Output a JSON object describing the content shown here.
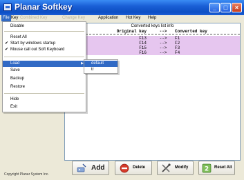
{
  "window": {
    "title": "Planar Softkey"
  },
  "menubar": {
    "items": [
      {
        "label": "File"
      },
      {
        "label": "Key"
      },
      {
        "label": "Combined Key"
      },
      {
        "label": "Change Key"
      },
      {
        "label": "Application"
      },
      {
        "label": "Hot Key"
      },
      {
        "label": "Help"
      }
    ]
  },
  "file_menu": {
    "items": [
      {
        "label": "Disable",
        "checked": false
      },
      {
        "label": "Reset All",
        "checked": false
      },
      {
        "label": "Start by windows startup",
        "checked": true,
        "check": "✔"
      },
      {
        "label": "Mouse call out Soft Keyboard",
        "checked": true,
        "check": "✔"
      },
      {
        "label": "Load",
        "has_submenu": true,
        "arrow": "▶"
      },
      {
        "label": "Save"
      },
      {
        "label": "Backup"
      },
      {
        "label": "Restore"
      },
      {
        "label": "Hide"
      },
      {
        "label": "Exit"
      }
    ]
  },
  "load_submenu": {
    "items": [
      {
        "label": "default"
      },
      {
        "label": "tr"
      }
    ]
  },
  "key_list": {
    "title": "Converted keys list info",
    "headers": {
      "original": "Original key",
      "arrow": "-->",
      "converted": "Converted key"
    },
    "rows": [
      {
        "original": "F13",
        "arrow": "-->",
        "converted": "F1"
      },
      {
        "original": "F14",
        "arrow": "-->",
        "converted": "F2"
      },
      {
        "original": "F15",
        "arrow": "-->",
        "converted": "F3"
      },
      {
        "original": "F16",
        "arrow": "-->",
        "converted": "F4"
      }
    ]
  },
  "buttons": {
    "add": "Add",
    "delete": "Delete",
    "modify": "Modify",
    "reset_all": "Reset All"
  },
  "footer": {
    "copyright": "Copyright Planar System Inc."
  },
  "colors": {
    "title_bar": "#1a5fd6",
    "selection": "#316ac5",
    "row_highlight": "#e6c6ef"
  }
}
